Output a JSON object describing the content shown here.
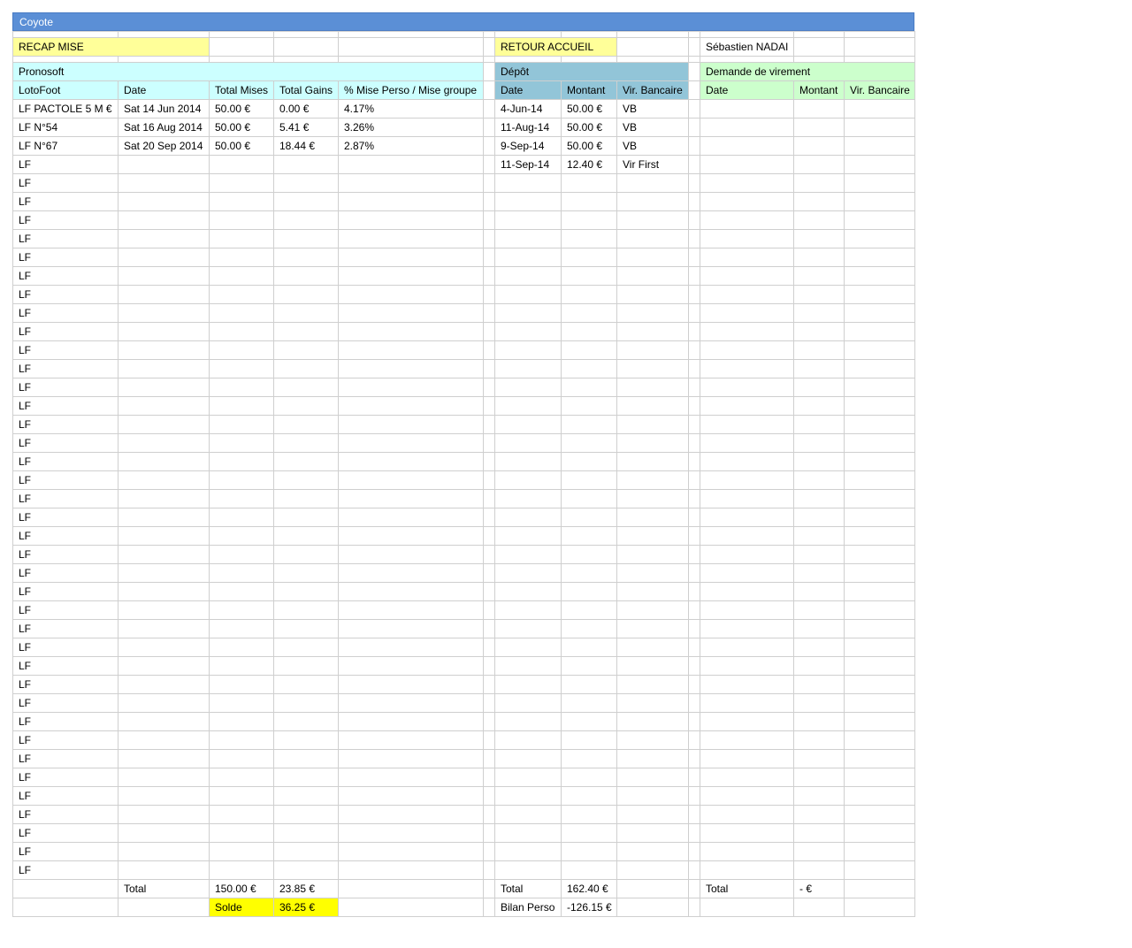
{
  "sheet_title": "Coyote",
  "buttons": {
    "recap": "RECAP MISE",
    "retour": "RETOUR ACCUEIL"
  },
  "user_name": "Sébastien NADAI",
  "sections": {
    "pronosoft": "Pronosoft",
    "depot": "Dépôt",
    "virement": "Demande de virement"
  },
  "headers": {
    "pronosoft": [
      "LotoFoot",
      "Date",
      "Total Mises",
      "Total Gains",
      "% Mise Perso / Mise groupe"
    ],
    "depot": [
      "Date",
      "Montant",
      "Vir. Bancaire"
    ],
    "virement": [
      "Date",
      "Montant",
      "Vir. Bancaire"
    ]
  },
  "rows": [
    {
      "lf": "LF PACTOLE 5 M €",
      "date": "Sat 14 Jun 2014",
      "mises": "50.00 €",
      "gains": "0.00 €",
      "pct": "4.17%",
      "d_date": "4-Jun-14",
      "d_montant": "50.00 €",
      "d_vir": "VB"
    },
    {
      "lf": "LF N°54",
      "date": "Sat 16 Aug 2014",
      "mises": "50.00 €",
      "gains": "5.41 €",
      "pct": "3.26%",
      "d_date": "11-Aug-14",
      "d_montant": "50.00 €",
      "d_vir": "VB"
    },
    {
      "lf": "LF N°67",
      "date": "Sat 20 Sep 2014",
      "mises": "50.00 €",
      "gains": "18.44 €",
      "pct": "2.87%",
      "d_date": "9-Sep-14",
      "d_montant": "50.00 €",
      "d_vir": "VB"
    },
    {
      "lf": "LF",
      "d_date": "11-Sep-14",
      "d_montant": "12.40 €",
      "d_vir": "Vir First"
    },
    {
      "lf": "LF"
    },
    {
      "lf": "LF"
    },
    {
      "lf": "LF"
    },
    {
      "lf": "LF"
    },
    {
      "lf": "LF"
    },
    {
      "lf": "LF"
    },
    {
      "lf": "LF"
    },
    {
      "lf": "LF"
    },
    {
      "lf": "LF"
    },
    {
      "lf": "LF"
    },
    {
      "lf": "LF"
    },
    {
      "lf": "LF"
    },
    {
      "lf": "LF"
    },
    {
      "lf": "LF"
    },
    {
      "lf": "LF"
    },
    {
      "lf": "LF"
    },
    {
      "lf": "LF"
    },
    {
      "lf": "LF"
    },
    {
      "lf": "LF"
    },
    {
      "lf": "LF"
    },
    {
      "lf": "LF"
    },
    {
      "lf": "LF"
    },
    {
      "lf": "LF"
    },
    {
      "lf": "LF"
    },
    {
      "lf": "LF"
    },
    {
      "lf": "LF"
    },
    {
      "lf": "LF"
    },
    {
      "lf": "LF"
    },
    {
      "lf": "LF"
    },
    {
      "lf": "LF"
    },
    {
      "lf": "LF"
    },
    {
      "lf": "LF"
    },
    {
      "lf": "LF"
    },
    {
      "lf": "LF"
    },
    {
      "lf": "LF"
    },
    {
      "lf": "LF"
    },
    {
      "lf": "LF"
    },
    {
      "lf": "LF"
    }
  ],
  "totals": {
    "label": "Total",
    "mises": "150.00 €",
    "gains": "23.85 €",
    "depot_label": "Total",
    "depot_montant": "162.40 €",
    "vir_label": "Total",
    "vir_montant": "- €"
  },
  "solde": {
    "label": "Solde",
    "value": "36.25 €",
    "bilan_label": "Bilan Perso",
    "bilan_value": "-126.15 €"
  },
  "colors": {
    "title_bar": "#5b8fd6",
    "yellow": "#ffff99",
    "cyan": "#ccffff",
    "steel": "#92c5d8",
    "green": "#ccffcc",
    "solde": "#ffff00"
  }
}
